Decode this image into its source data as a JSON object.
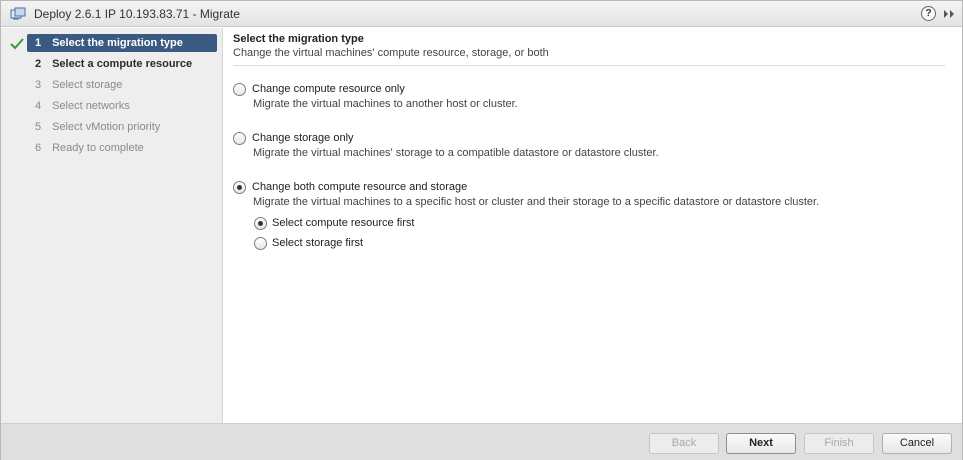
{
  "window": {
    "title": "Deploy 2.6.1 IP 10.193.83.71 - Migrate",
    "help_label": "?"
  },
  "wizard": {
    "steps": [
      {
        "num": "1",
        "label": "Select the migration type",
        "state": "active"
      },
      {
        "num": "2",
        "label": "Select a compute resource",
        "state": "current"
      },
      {
        "num": "3",
        "label": "Select storage",
        "state": "disabled"
      },
      {
        "num": "4",
        "label": "Select networks",
        "state": "disabled"
      },
      {
        "num": "5",
        "label": "Select vMotion priority",
        "state": "disabled"
      },
      {
        "num": "6",
        "label": "Ready to complete",
        "state": "disabled"
      }
    ]
  },
  "content": {
    "heading": "Select the migration type",
    "subheading": "Change the virtual machines' compute resource, storage, or both",
    "options": [
      {
        "label": "Change compute resource only",
        "description": "Migrate the virtual machines to another host or cluster.",
        "selected": false
      },
      {
        "label": "Change storage only",
        "description": "Migrate the virtual machines' storage to a compatible datastore or datastore cluster.",
        "selected": false
      },
      {
        "label": "Change both compute resource and storage",
        "description": "Migrate the virtual machines to a specific host or cluster and their storage to a specific datastore or datastore cluster.",
        "selected": true
      }
    ],
    "sub_options": [
      {
        "label": "Select compute resource first",
        "selected": true
      },
      {
        "label": "Select storage first",
        "selected": false
      }
    ]
  },
  "footer": {
    "back_label": "Back",
    "next_label": "Next",
    "finish_label": "Finish",
    "cancel_label": "Cancel"
  },
  "colors": {
    "active_step_bg": "#3a5a82",
    "check_green": "#3c9a3c",
    "footer_bg": "#dfdfdf",
    "sidebar_bg": "#eeeeee"
  }
}
